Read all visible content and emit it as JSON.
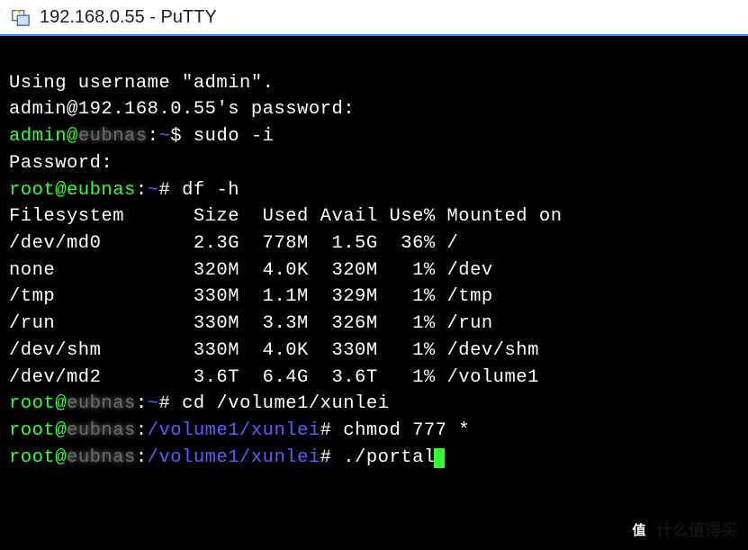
{
  "title": "192.168.0.55 - PuTTY",
  "login": {
    "using_username": "Using username \"admin\".",
    "password_prompt_user": "admin@192.168.0.55",
    "password_prompt_suffix": "'s password:"
  },
  "prompts": [
    {
      "user": "admin@",
      "host_blur": "eubnas",
      "sep": ":",
      "path": "~",
      "symbol": "$ ",
      "cmd": "sudo -i"
    }
  ],
  "password_line": "Password:",
  "root1": {
    "user": "root@eubnas",
    "sep": ":",
    "path": "~",
    "symbol": "# ",
    "cmd": "df -h"
  },
  "df": {
    "header": "Filesystem      Size  Used Avail Use% Mounted on",
    "rows": [
      "/dev/md0        2.3G  778M  1.5G  36% /",
      "none            320M  4.0K  320M   1% /dev",
      "/tmp            330M  1.1M  329M   1% /tmp",
      "/run            330M  3.3M  326M   1% /run",
      "/dev/shm        330M  4.0K  330M   1% /dev/shm",
      "/dev/md2        3.6T  6.4G  3.6T   1% /volume1"
    ]
  },
  "root2": {
    "user": "root@",
    "host_blur": "eubnas",
    "sep": ":",
    "path": "~",
    "symbol": "# ",
    "cmd": "cd /volume1/xunlei"
  },
  "root3": {
    "user": "root@",
    "host_blur": "eubnas",
    "sep": ":",
    "path": "/volume1/xunlei",
    "symbol": "# ",
    "cmd": "chmod 777 *"
  },
  "root4": {
    "user": "root@",
    "host_blur": "eubnas",
    "sep": ":",
    "path": "/volume1/xunlei",
    "symbol": "# ",
    "cmd": "./portal"
  },
  "watermark": {
    "badge": "值",
    "text": "什么值得买"
  }
}
